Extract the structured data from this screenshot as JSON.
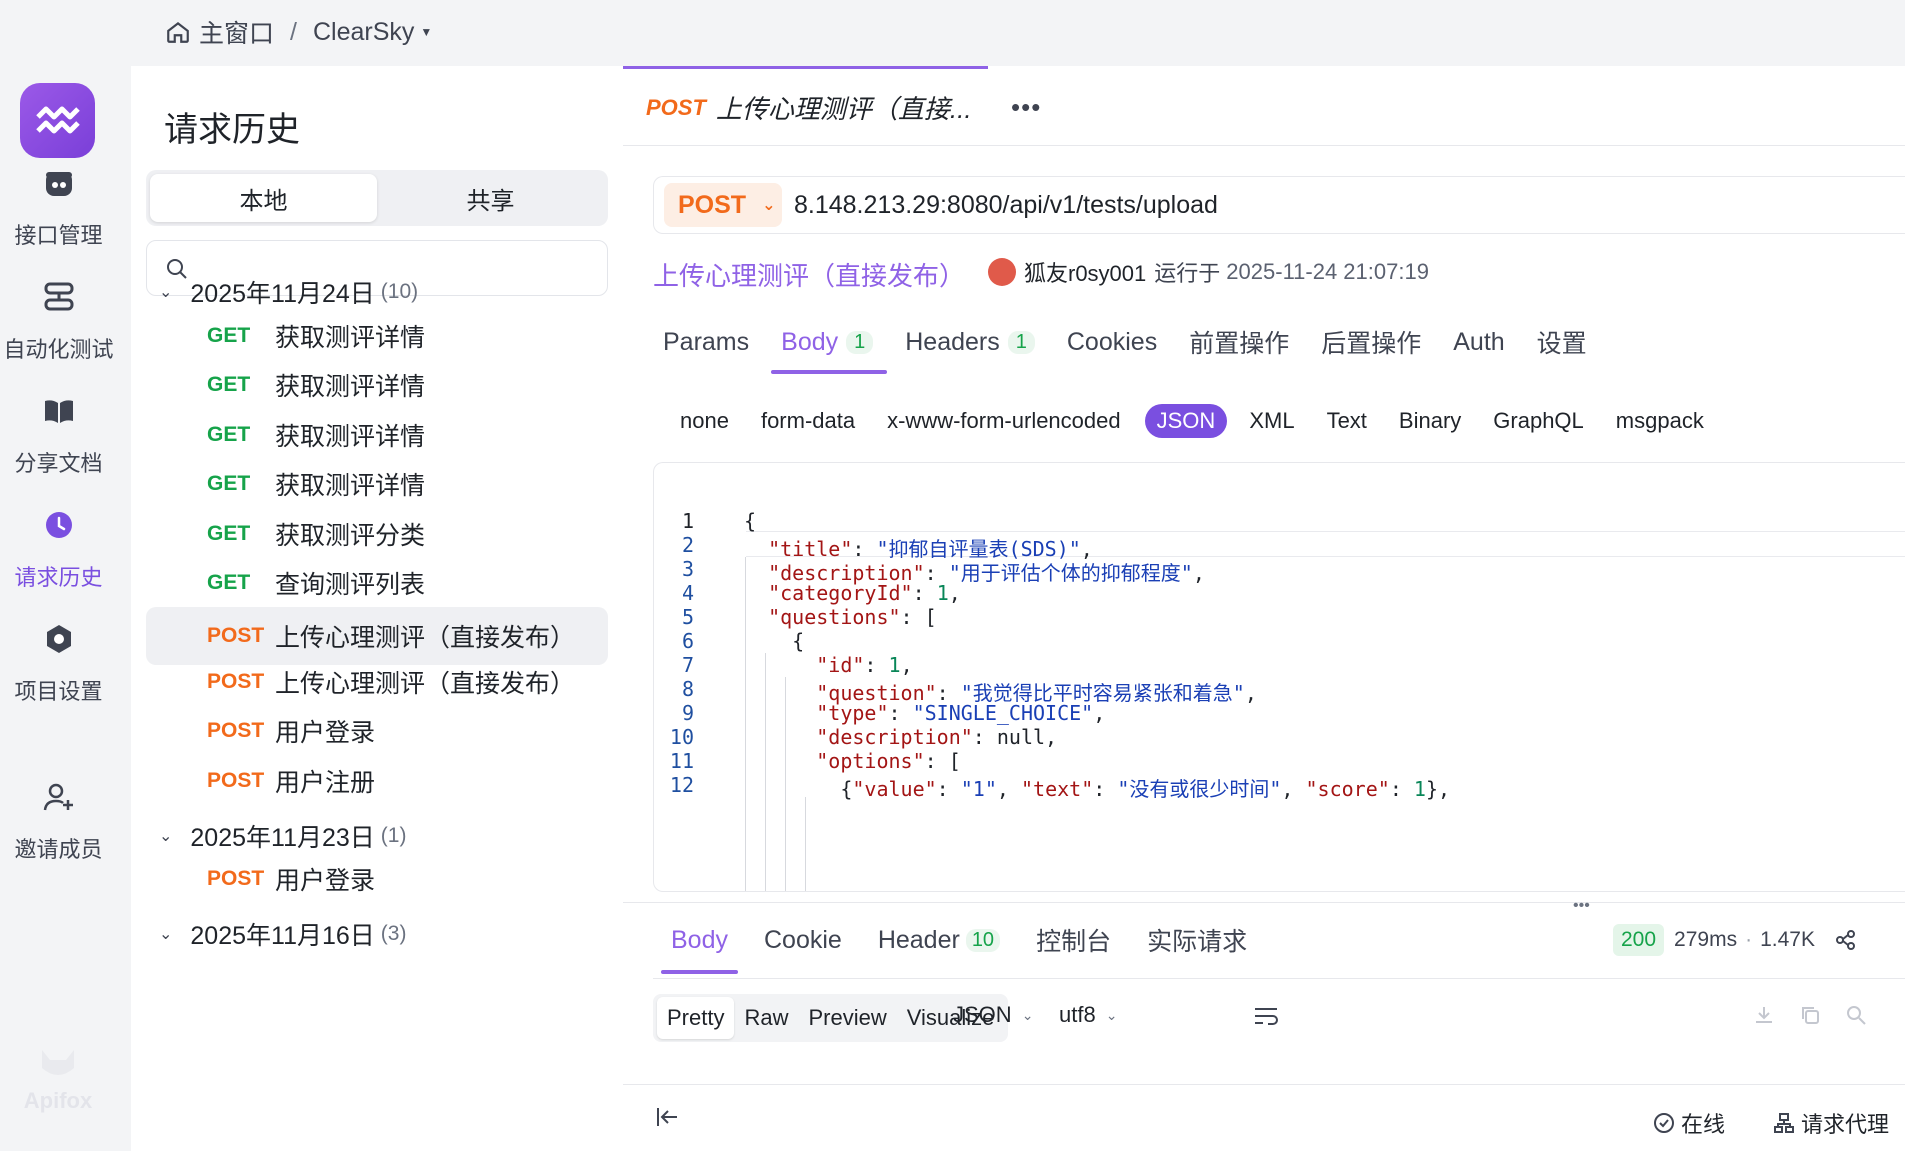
{
  "breadcrumb": {
    "home": "主窗口",
    "separator": "/",
    "project": "ClearSky"
  },
  "app_name": "Apifox",
  "rail": [
    {
      "label": "接口管理",
      "icon": "api-icon"
    },
    {
      "label": "自动化测试",
      "icon": "automation-icon"
    },
    {
      "label": "分享文档",
      "icon": "book-icon"
    },
    {
      "label": "请求历史",
      "icon": "clock-icon",
      "active": true
    },
    {
      "label": "项目设置",
      "icon": "settings-hex-icon"
    },
    {
      "label": "邀请成员",
      "icon": "user-plus-icon"
    }
  ],
  "history": {
    "title": "请求历史",
    "tabs": [
      "本地",
      "共享"
    ],
    "active_tab": "本地",
    "search_placeholder": "",
    "groups": [
      {
        "date": "2025年11月24日",
        "count": "(10)",
        "items": [
          {
            "method": "GET",
            "name": "获取测评详情"
          },
          {
            "method": "GET",
            "name": "获取测评详情"
          },
          {
            "method": "GET",
            "name": "获取测评详情"
          },
          {
            "method": "GET",
            "name": "获取测评详情"
          },
          {
            "method": "GET",
            "name": "获取测评分类"
          },
          {
            "method": "GET",
            "name": "查询测评列表"
          },
          {
            "method": "POST",
            "name": "上传心理测评（直接发布）"
          },
          {
            "method": "POST",
            "name": "上传心理测评（直接发布）"
          },
          {
            "method": "POST",
            "name": "用户登录"
          },
          {
            "method": "POST",
            "name": "用户注册"
          }
        ]
      },
      {
        "date": "2025年11月23日",
        "count": "(1)",
        "items": [
          {
            "method": "POST",
            "name": "用户登录"
          }
        ]
      },
      {
        "date": "2025年11月16日",
        "count": "(3)",
        "items": []
      }
    ]
  },
  "tab": {
    "method": "POST",
    "title": "上传心理测评（直接..."
  },
  "request": {
    "method": "POST",
    "url": "8.148.213.29:8080/api/v1/tests/upload",
    "name": "上传心理测评（直接发布）",
    "runner": "狐友r0sy001",
    "run_label": "运行于",
    "run_time": "2025-11-24 21:07:19"
  },
  "param_tabs": [
    {
      "label": "Params"
    },
    {
      "label": "Body",
      "badge": "1",
      "active": true
    },
    {
      "label": "Headers",
      "badge": "1"
    },
    {
      "label": "Cookies"
    },
    {
      "label": "前置操作"
    },
    {
      "label": "后置操作"
    },
    {
      "label": "Auth"
    },
    {
      "label": "设置"
    }
  ],
  "body_types": [
    "none",
    "form-data",
    "x-www-form-urlencoded",
    "JSON",
    "XML",
    "Text",
    "Binary",
    "GraphQL",
    "msgpack"
  ],
  "active_body_type": "JSON",
  "code_lines": [
    "{",
    "  \"title\": \"抑郁自评量表(SDS)\",",
    "  \"description\": \"用于评估个体的抑郁程度\",",
    "  \"categoryId\": 1,",
    "  \"questions\": [",
    "    {",
    "      \"id\": 1,",
    "      \"question\": \"我觉得比平时容易紧张和着急\",",
    "      \"type\": \"SINGLE_CHOICE\",",
    "      \"description\": null,",
    "      \"options\": [",
    "        {\"value\": \"1\", \"text\": \"没有或很少时间\", \"score\": 1},"
  ],
  "response": {
    "tabs": [
      {
        "label": "Body",
        "active": true
      },
      {
        "label": "Cookie"
      },
      {
        "label": "Header",
        "badge": "10"
      },
      {
        "label": "控制台"
      },
      {
        "label": "实际请求"
      }
    ],
    "status": "200",
    "time": "279ms",
    "size": "1.47K",
    "view_tabs": [
      "Pretty",
      "Raw",
      "Preview",
      "Visualize"
    ],
    "active_view": "Pretty",
    "format": "JSON",
    "encoding": "utf8"
  },
  "statusbar": {
    "online": "在线",
    "proxy": "请求代理"
  },
  "colors": {
    "accent": "#8f62e6",
    "get": "#16a34a",
    "post": "#f26a1b"
  }
}
